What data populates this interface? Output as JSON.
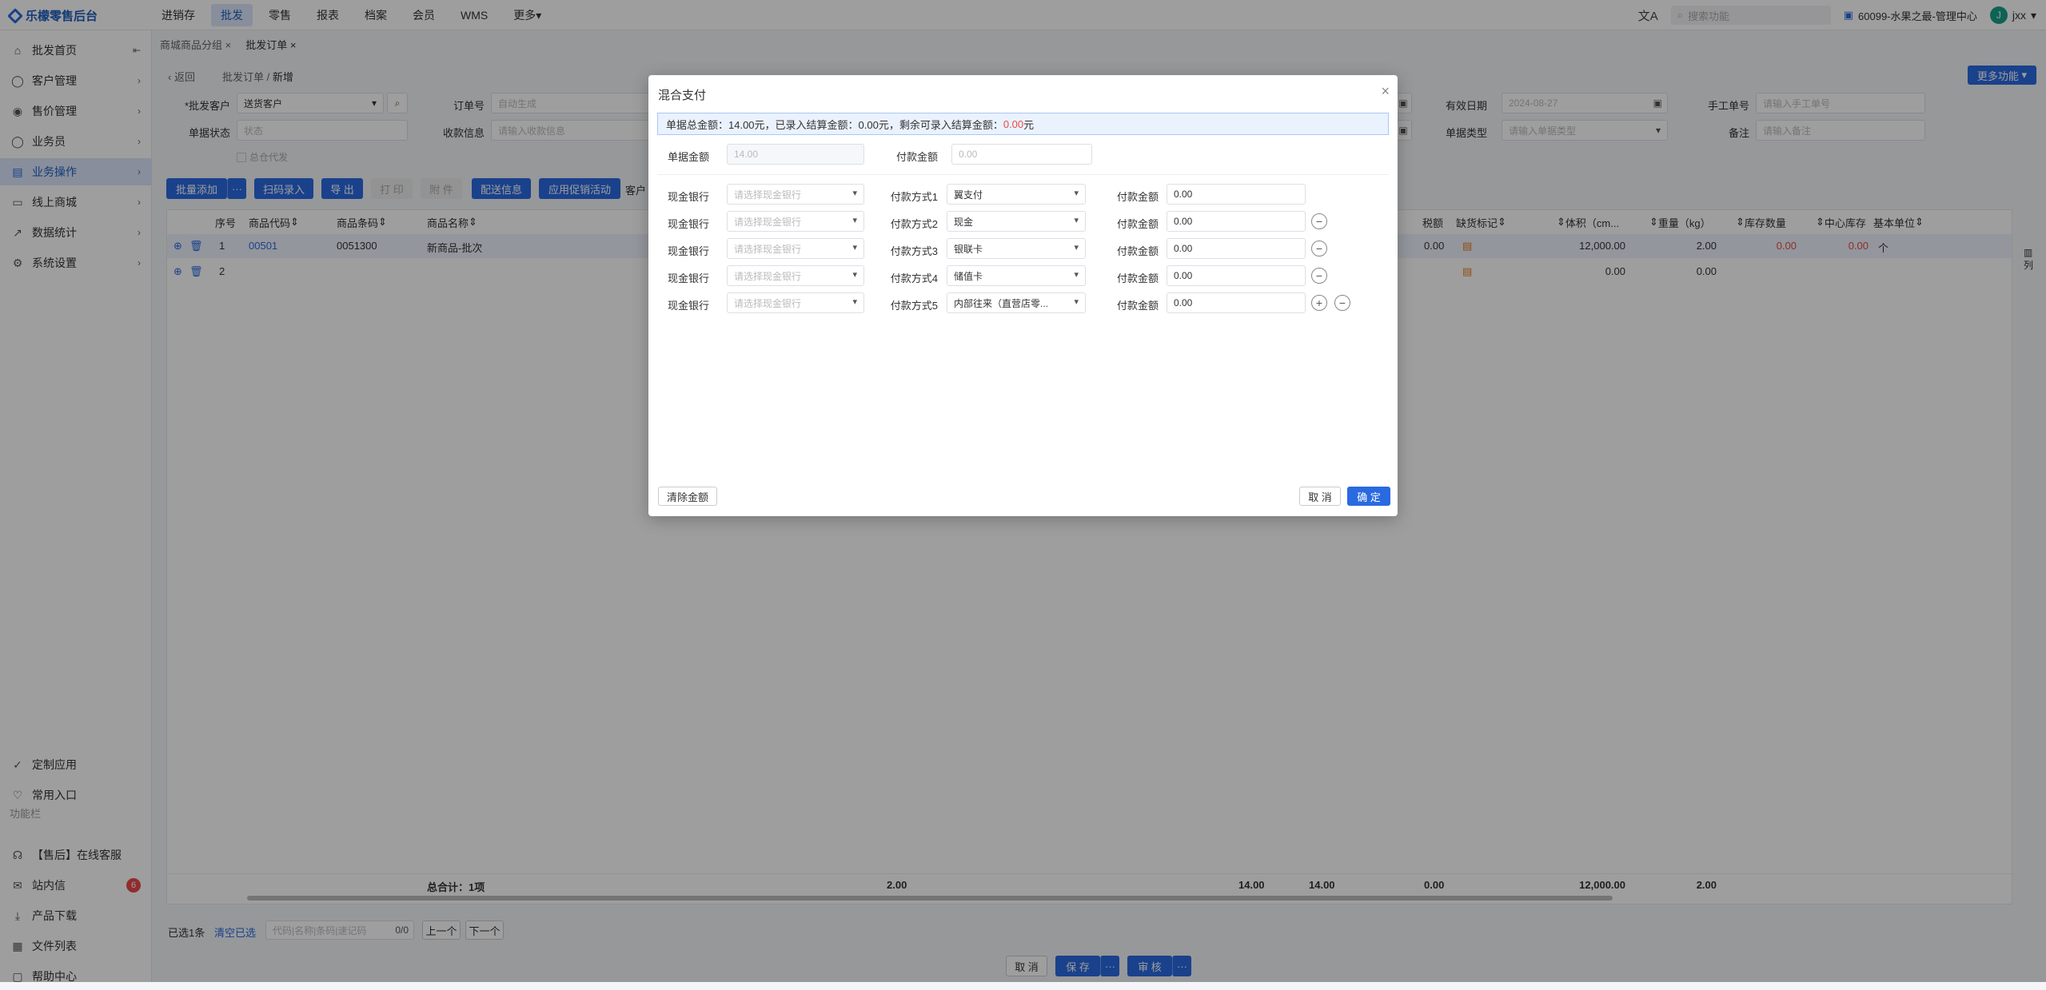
{
  "app": {
    "title": "乐檬零售后台"
  },
  "topnav": [
    "进销存",
    "批发",
    "零售",
    "报表",
    "档案",
    "会员",
    "WMS",
    "更多"
  ],
  "topnav_active": 1,
  "top_right": {
    "search_placeholder": "搜索功能",
    "store": "60099-水果之最-管理中心",
    "avatar_letter": "J",
    "user": "jxx"
  },
  "sidebar": {
    "items": [
      "批发首页",
      "客户管理",
      "售价管理",
      "业务员",
      "业务操作",
      "线上商城",
      "数据统计",
      "系统设置"
    ],
    "bottom_items": [
      "定制应用",
      "常用入口"
    ],
    "section_label": "功能栏",
    "tools": [
      "【售后】在线客服",
      "站内信",
      "产品下载",
      "文件列表",
      "帮助中心"
    ],
    "badge": "6"
  },
  "tabs": [
    "商城商品分组",
    "批发订单"
  ],
  "breadcrumb": {
    "back": "返回",
    "path1": "批发订单",
    "sep": "/",
    "path2": "新增"
  },
  "form": {
    "customer_label": "*批发客户",
    "customer_value": "送货客户",
    "order_no_label": "订单号",
    "order_no_placeholder": "自动生成",
    "status_label": "单据状态",
    "status_placeholder": "状态",
    "collect_label": "收款信息",
    "collect_placeholder": "请输入收款信息",
    "valid_date_label": "有效日期",
    "valid_date_value": "2024-08-27",
    "manual_label": "手工单号",
    "manual_placeholder": "请输入手工单号",
    "doc_type_label": "单据类型",
    "doc_type_placeholder": "请输入单据类型",
    "remark_label": "备注",
    "remark_placeholder": "请输入备注",
    "proxy_label": "总仓代发"
  },
  "more_button": "更多功能",
  "toolbar": {
    "batch_add": "批量添加",
    "dots": "···",
    "scan": "扫码录入",
    "export": "导 出",
    "print": "打 印",
    "attach": "附 件",
    "delivery": "配送信息",
    "promo": "应用促销活动",
    "customer_short": "客户"
  },
  "grid": {
    "headers": [
      "序号",
      "商品代码",
      "商品条码",
      "商品名称",
      "税额",
      "缺货标记",
      "体积（cm...",
      "重量（kg）",
      "库存数量",
      "中心库存",
      "基本单位"
    ],
    "rows": [
      {
        "idx": "1",
        "code": "00501",
        "barcode": "0051300",
        "name": "新商品-批次",
        "tax": "0.00",
        "volume": "12,000.00",
        "weight": "2.00",
        "stock": "0.00",
        "center": "0.00",
        "unit": "个"
      },
      {
        "idx": "2",
        "code": "",
        "barcode": "",
        "name": "",
        "tax": "",
        "volume": "0.00",
        "weight": "0.00",
        "stock": "",
        "center": "",
        "unit": ""
      }
    ],
    "total_label": "总合计：1项",
    "totals": [
      "2.00",
      "14.00",
      "14.00",
      "0.00",
      "12,000.00",
      "2.00"
    ],
    "col_toggle": "列"
  },
  "footer": {
    "selected": "已选1条",
    "clear": "清空已选",
    "search_placeholder": "代码|名称|条码|速记码",
    "count": "0/0",
    "prev": "上一个",
    "next": "下一个"
  },
  "bottom_actions": {
    "cancel": "取 消",
    "save": "保 存",
    "audit": "审 核",
    "dots": "···"
  },
  "modal": {
    "title": "混合支付",
    "info_prefix": "单据总金额：14.00元，已录入结算金额：0.00元，剩余可录入结算金额：",
    "info_red": "0.00",
    "info_suffix": "元",
    "doc_amount_label": "单据金额",
    "doc_amount_value": "14.00",
    "pay_amount_label": "付款金额",
    "pay_amount_placeholder": "0.00",
    "rows": [
      {
        "bank_label": "现金银行",
        "bank_placeholder": "请选择现金银行",
        "method_label": "付款方式1",
        "method": "翼支付",
        "amount_label": "付款金额",
        "amount": "0.00"
      },
      {
        "bank_label": "现金银行",
        "bank_placeholder": "请选择现金银行",
        "method_label": "付款方式2",
        "method": "现金",
        "amount_label": "付款金额",
        "amount": "0.00"
      },
      {
        "bank_label": "现金银行",
        "bank_placeholder": "请选择现金银行",
        "method_label": "付款方式3",
        "method": "银联卡",
        "amount_label": "付款金额",
        "amount": "0.00"
      },
      {
        "bank_label": "现金银行",
        "bank_placeholder": "请选择现金银行",
        "method_label": "付款方式4",
        "method": "储值卡",
        "amount_label": "付款金额",
        "amount": "0.00"
      },
      {
        "bank_label": "现金银行",
        "bank_placeholder": "请选择现金银行",
        "method_label": "付款方式5",
        "method": "内部往来（直营店零...",
        "amount_label": "付款金额",
        "amount": "0.00"
      }
    ],
    "clear_button": "清除金额",
    "cancel_button": "取 消",
    "ok_button": "确 定"
  },
  "colors": {
    "primary": "#2a6ae0",
    "active_bg": "#dbe6fa",
    "danger": "#e84a4a",
    "overlay": "rgba(0,0,0,0.38)"
  }
}
